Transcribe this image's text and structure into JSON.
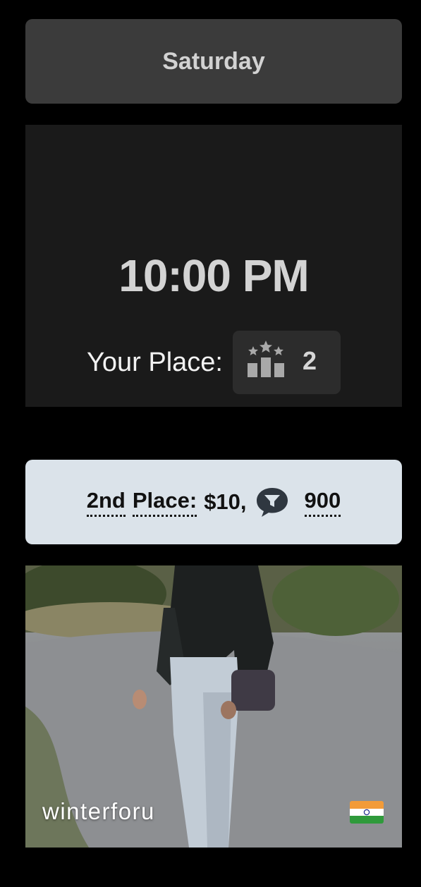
{
  "schedule": {
    "day": "Saturday",
    "time": "10:00 PM",
    "your_place_label": "Your Place:",
    "your_place_value": "2",
    "podium_icon": "podium-stars-icon"
  },
  "prize": {
    "place_word": "2nd",
    "place_suffix": "Place:",
    "amount_prefix": "$10,",
    "amount_suffix": "900",
    "icon": "chat-filter-icon"
  },
  "entry": {
    "username": "winterforu",
    "flag": "india-flag-icon"
  },
  "colors": {
    "background": "#000000",
    "day_header_bg": "#3b3b3b",
    "time_card_bg": "#1a1a1a",
    "prize_banner_bg": "#dbe3ea"
  }
}
